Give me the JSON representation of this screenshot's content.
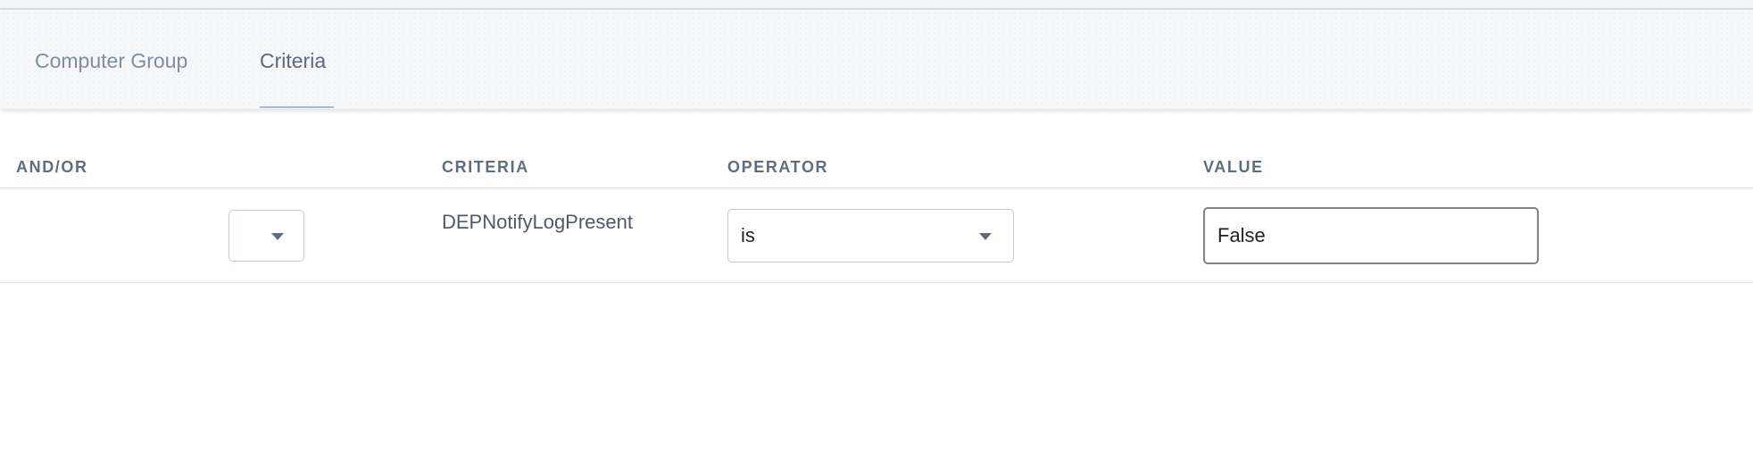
{
  "tabs": [
    {
      "label": "Computer Group",
      "active": false
    },
    {
      "label": "Criteria",
      "active": true
    }
  ],
  "table": {
    "headers": {
      "and_or": "AND/OR",
      "criteria": "CRITERIA",
      "operator": "OPERATOR",
      "value": "VALUE"
    },
    "rows": [
      {
        "and_or": "",
        "criteria": "DEPNotifyLogPresent",
        "operator": "is",
        "value": "False"
      }
    ]
  },
  "icons": {
    "dropdown": "chevron-down-icon"
  },
  "colors": {
    "active_tab_underline": "#a9b9d3",
    "header_text": "#5e6e81"
  }
}
